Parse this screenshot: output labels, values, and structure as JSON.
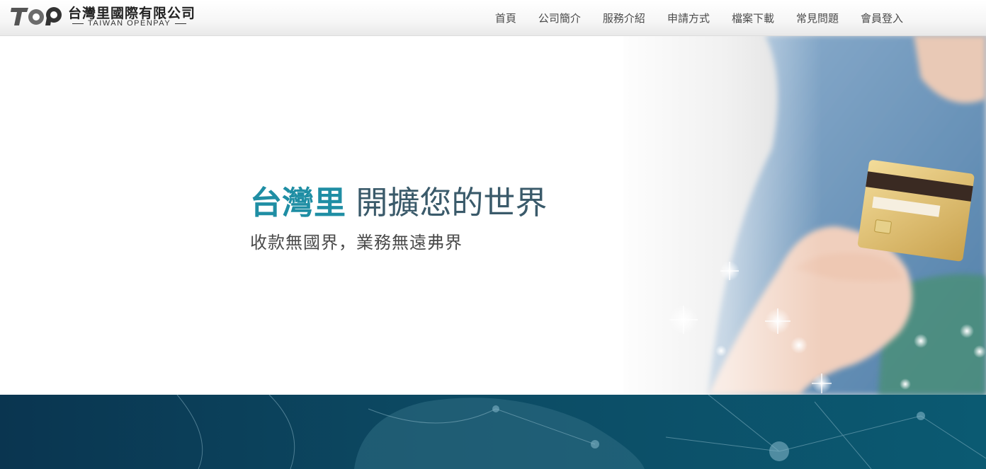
{
  "header": {
    "logo": {
      "mark": "TOP",
      "name": "台灣里國際有限公司",
      "subtitle": "TAIWAN OPENPAY"
    },
    "nav": [
      {
        "label": "首頁"
      },
      {
        "label": "公司簡介"
      },
      {
        "label": "服務介紹"
      },
      {
        "label": "申請方式"
      },
      {
        "label": "檔案下載"
      },
      {
        "label": "常見問題"
      },
      {
        "label": "會員登入"
      }
    ]
  },
  "hero": {
    "brand": "台灣里",
    "headline": "開擴您的世界",
    "subline": "收款無國界，業務無遠弗界",
    "image": "woman-holding-credit-card"
  },
  "band": {
    "image": "global-network-globe"
  },
  "colors": {
    "brand": "#1f8ea4",
    "headline": "#3a5a6a",
    "band": "#0b4a63"
  }
}
